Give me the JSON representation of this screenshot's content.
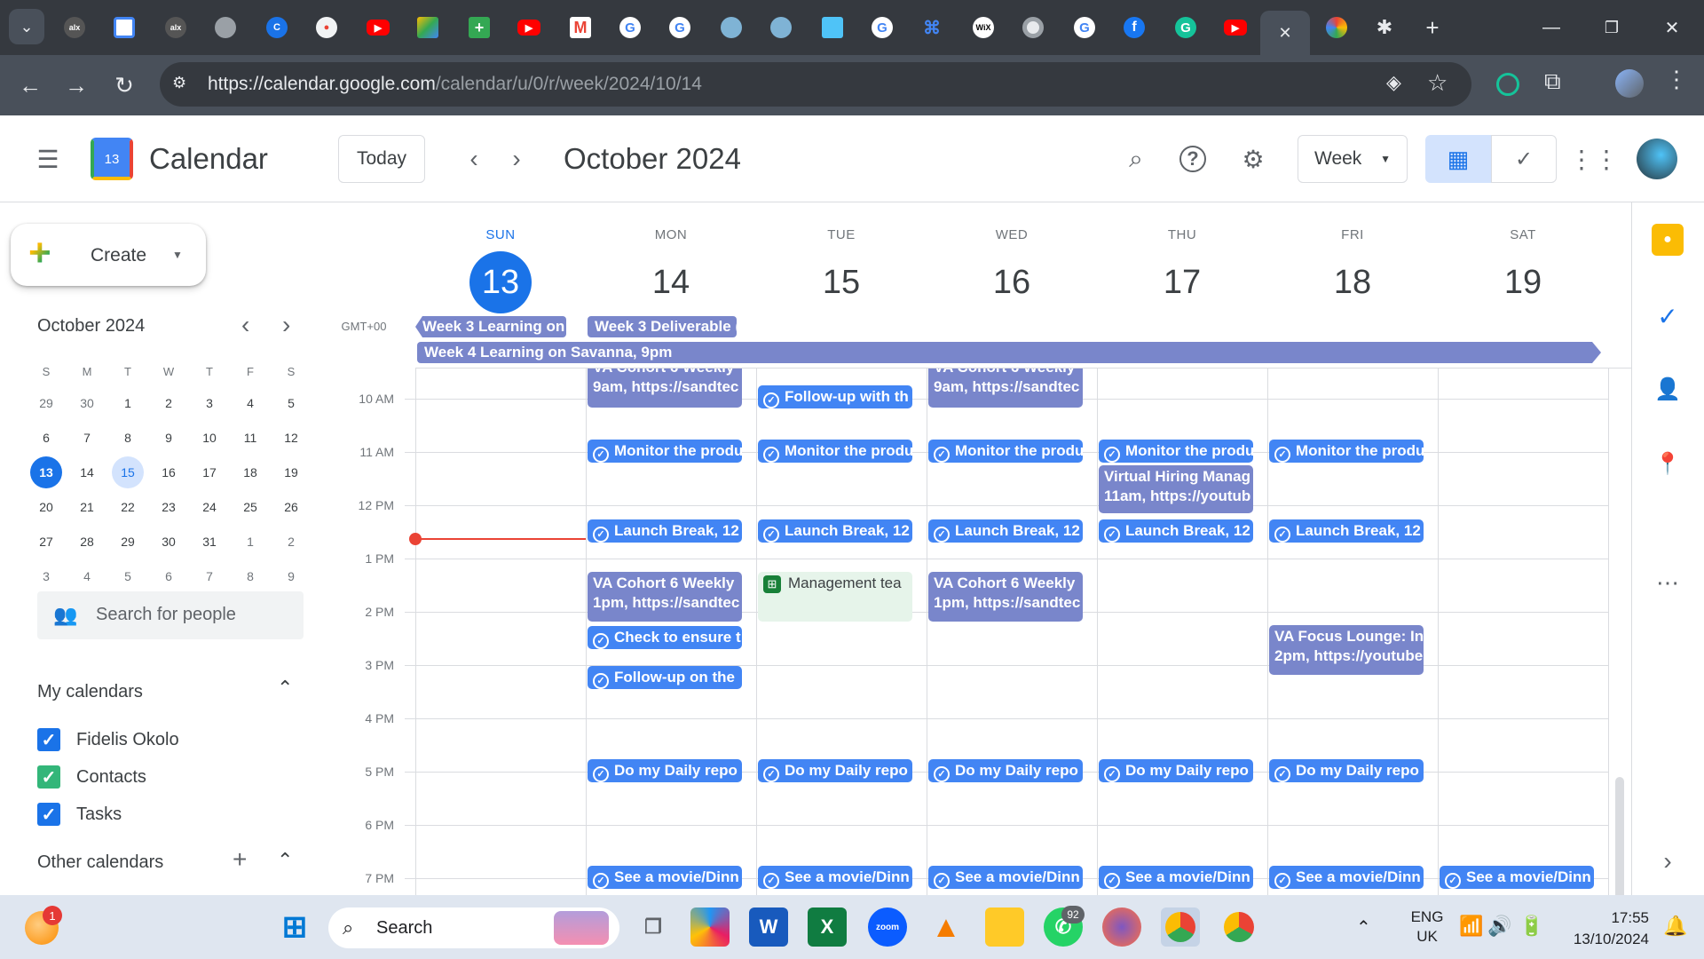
{
  "browser": {
    "url_domain": "https://calendar.google.com",
    "url_path": "/calendar/u/0/r/week/2024/10/14",
    "close_tab_glyph": "✕",
    "new_tab_glyph": "+"
  },
  "app": {
    "title": "Calendar",
    "logo_number": "13",
    "today_label": "Today",
    "period_title": "October 2024",
    "view_select": "Week",
    "create_label": "Create"
  },
  "mini_calendar": {
    "title": "October 2024",
    "weekday_headers": [
      "S",
      "M",
      "T",
      "W",
      "T",
      "F",
      "S"
    ],
    "weeks": [
      [
        "29",
        "30",
        "1",
        "2",
        "3",
        "4",
        "5"
      ],
      [
        "6",
        "7",
        "8",
        "9",
        "10",
        "11",
        "12"
      ],
      [
        "13",
        "14",
        "15",
        "16",
        "17",
        "18",
        "19"
      ],
      [
        "20",
        "21",
        "22",
        "23",
        "24",
        "25",
        "26"
      ],
      [
        "27",
        "28",
        "29",
        "30",
        "31",
        "1",
        "2"
      ],
      [
        "3",
        "4",
        "5",
        "6",
        "7",
        "8",
        "9"
      ]
    ]
  },
  "sidebar": {
    "search_people_placeholder": "Search for people",
    "my_calendars_title": "My calendars",
    "calendars": [
      {
        "label": "Fidelis Okolo",
        "color": "#1a73e8"
      },
      {
        "label": "Contacts",
        "color": "#33b679"
      },
      {
        "label": "Tasks",
        "color": "#1a73e8"
      }
    ],
    "other_calendars_title": "Other calendars"
  },
  "week": {
    "timezone": "GMT+00",
    "days": [
      {
        "name": "SUN",
        "num": "13"
      },
      {
        "name": "MON",
        "num": "14"
      },
      {
        "name": "TUE",
        "num": "15"
      },
      {
        "name": "WED",
        "num": "16"
      },
      {
        "name": "THU",
        "num": "17"
      },
      {
        "name": "FRI",
        "num": "18"
      },
      {
        "name": "SAT",
        "num": "19"
      }
    ],
    "hours": [
      "10 AM",
      "11 AM",
      "12 PM",
      "1 PM",
      "2 PM",
      "3 PM",
      "4 PM",
      "5 PM",
      "6 PM",
      "7 PM"
    ],
    "allday_events": [
      "Week 3 Learning on",
      "Week 3 Deliverable (",
      "Week 4 Learning on Savanna, 9pm"
    ],
    "events": {
      "va_cohort_9am_title": "VA Cohort 6 Weekly",
      "va_cohort_9am_sub": "9am, https://sandtec",
      "followup_tue": "Follow-up with th",
      "monitor": "Monitor the produ",
      "virtual_hiring_title": "Virtual Hiring Manag",
      "virtual_hiring_sub": "11am, https://youtub",
      "launch_break": "Launch Break, 12",
      "va_cohort_1pm_title": "VA Cohort 6 Weekly",
      "va_cohort_1pm_sub": "1pm, https://sandtec",
      "management": "Management tea",
      "va_focus_title": "VA Focus Lounge: In",
      "va_focus_sub": "2pm, https://youtube",
      "check_ensure": "Check to ensure t",
      "followup_mon": "Follow-up on the",
      "daily_report": "Do my Daily repo",
      "movie": "See a movie/Dinn"
    },
    "colors": {
      "lavender": "#7986cb",
      "blue": "#4285f4",
      "now_line": "#ea4335",
      "today": "#1a73e8"
    }
  },
  "taskbar": {
    "search_label": "Search",
    "lang_top": "ENG",
    "lang_bottom": "UK",
    "time": "17:55",
    "date": "13/10/2024",
    "whatsapp_badge": "92",
    "weather_badge": "1"
  }
}
